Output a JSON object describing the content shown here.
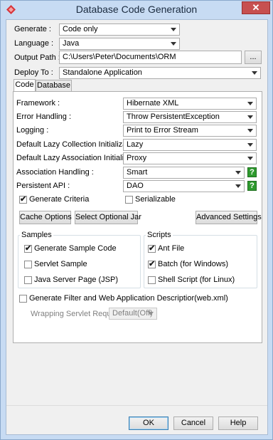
{
  "window": {
    "title": "Database Code Generation",
    "close_glyph": "✕"
  },
  "form": {
    "generate": {
      "label": "Generate :",
      "value": "Code only"
    },
    "language": {
      "label": "Language :",
      "value": "Java"
    },
    "output_path": {
      "label": "Output Path :",
      "value": "C:\\Users\\Peter\\Documents\\ORM",
      "browse_label": "..."
    },
    "deploy_to": {
      "label": "Deploy To :",
      "value": "Standalone Application"
    }
  },
  "tabs": [
    {
      "label": "Code",
      "selected": true
    },
    {
      "label": "Database",
      "selected": false
    }
  ],
  "code_tab": {
    "framework": {
      "label": "Framework :",
      "value": "Hibernate XML"
    },
    "error_handling": {
      "label": "Error Handling :",
      "value": "Throw PersistentException"
    },
    "logging": {
      "label": "Logging :",
      "value": "Print to Error Stream"
    },
    "lazy_collection": {
      "label": "Default Lazy Collection Initialization :",
      "value": "Lazy"
    },
    "lazy_association": {
      "label": "Default Lazy Association Initialization :",
      "value": "Proxy"
    },
    "association_handling": {
      "label": "Association Handling :",
      "value": "Smart",
      "help": "?"
    },
    "persistent_api": {
      "label": "Persistent API :",
      "value": "DAO",
      "help": "?"
    },
    "generate_criteria": {
      "label": "Generate Criteria",
      "checked": true
    },
    "serializable": {
      "label": "Serializable",
      "checked": false
    },
    "buttons": {
      "cache_options": "Cache Options",
      "select_optional_jar": "Select Optional Jar",
      "advanced_settings": "Advanced Settings"
    },
    "samples": {
      "title": "Samples",
      "items": [
        {
          "label": "Generate Sample Code",
          "checked": true
        },
        {
          "label": "Servlet Sample",
          "checked": false
        },
        {
          "label": "Java Server Page (JSP)",
          "checked": false
        }
      ]
    },
    "scripts": {
      "title": "Scripts",
      "items": [
        {
          "label": "Ant File",
          "checked": true
        },
        {
          "label": "Batch (for Windows)",
          "checked": true
        },
        {
          "label": "Shell Script (for Linux)",
          "checked": false
        }
      ]
    },
    "filter_descriptor": {
      "label": "Generate Filter and Web Application Descriptior(web.xml)",
      "checked": false
    },
    "wrapping_servlet": {
      "label": "Wrapping Servlet Request :",
      "value": "Default(Off)"
    }
  },
  "footer": {
    "ok": "OK",
    "cancel": "Cancel",
    "help": "Help"
  },
  "check_glyph": "✔"
}
